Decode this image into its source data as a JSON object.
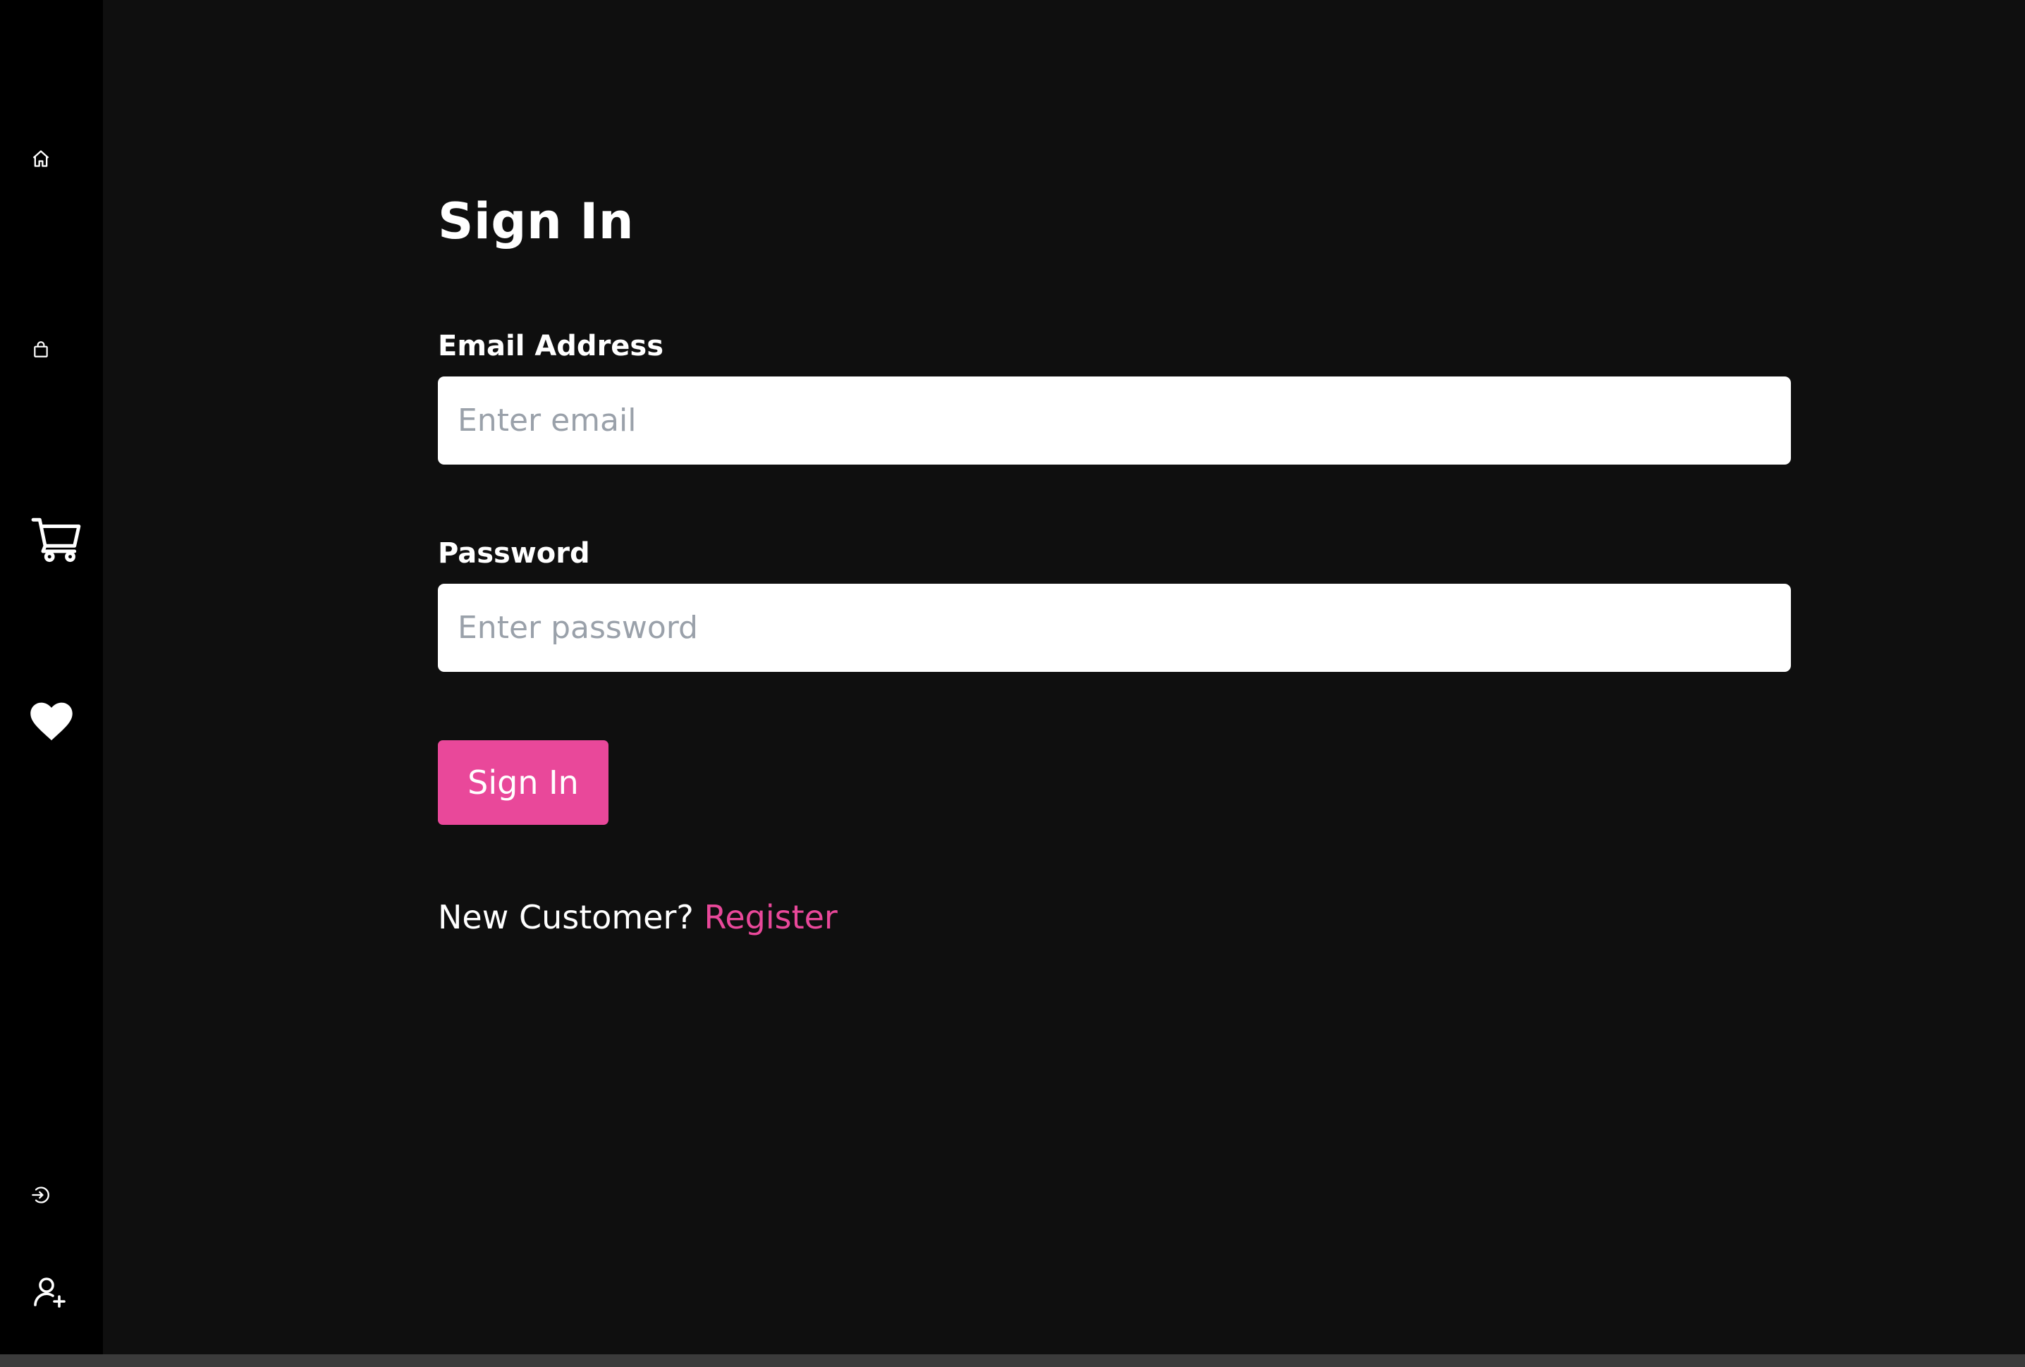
{
  "sidebar": {
    "icons": [
      "home-icon",
      "bag-icon",
      "cart-icon",
      "heart-icon",
      "login-icon",
      "user-add-icon"
    ]
  },
  "form": {
    "title": "Sign In",
    "email": {
      "label": "Email Address",
      "placeholder": "Enter email",
      "value": ""
    },
    "password": {
      "label": "Password",
      "placeholder": "Enter password",
      "value": ""
    },
    "submit_label": "Sign In",
    "register_prompt": "New Customer?",
    "register_link": "Register"
  },
  "colors": {
    "accent": "#e9489a",
    "sidebar_bg": "#000000",
    "page_bg": "#0f0f0f",
    "text": "#ffffff",
    "placeholder": "#9aa1aa"
  }
}
